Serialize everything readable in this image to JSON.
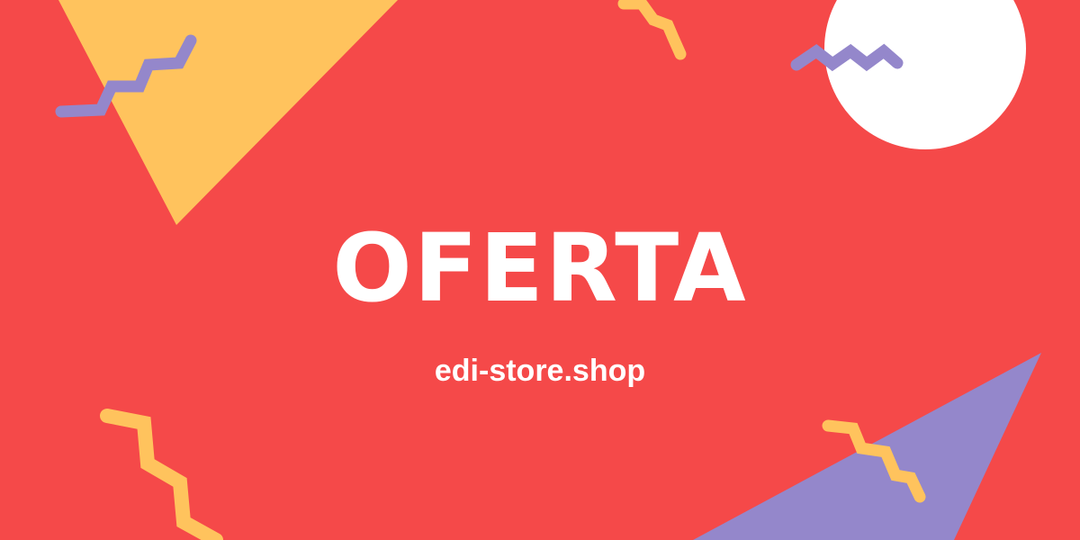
{
  "banner": {
    "headline": "OFERTA",
    "website": "edi-store.shop"
  },
  "colors": {
    "background": "#f54949",
    "yellow": "#ffc35d",
    "purple": "#9487cb",
    "white": "#ffffff"
  },
  "decorations": [
    "yellow-triangle",
    "purple-zigzag",
    "yellow-zigzag",
    "white-circle",
    "purple-triangle"
  ]
}
